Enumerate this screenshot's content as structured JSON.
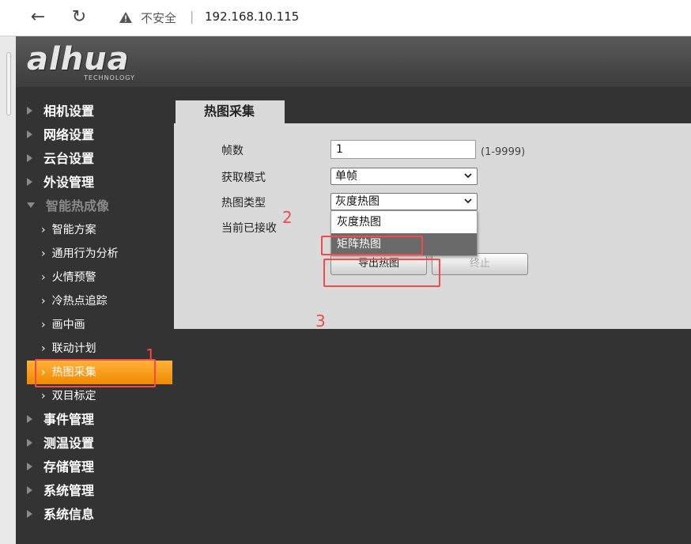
{
  "browser": {
    "back_icon": "←",
    "reload_icon": "↻",
    "insecure_label": "不安全",
    "separator": "|",
    "url": "192.168.10.115"
  },
  "header": {
    "logo": "alhua",
    "logo_sub": "TECHNOLOGY"
  },
  "sidebar": {
    "top_items": [
      {
        "label": "相机设置"
      },
      {
        "label": "网络设置"
      },
      {
        "label": "云台设置"
      },
      {
        "label": "外设管理"
      },
      {
        "label": "智能热成像"
      }
    ],
    "sub_items": [
      {
        "label": "智能方案"
      },
      {
        "label": "通用行为分析"
      },
      {
        "label": "火情预警"
      },
      {
        "label": "冷热点追踪"
      },
      {
        "label": "画中画"
      },
      {
        "label": "联动计划"
      },
      {
        "label": "热图采集"
      },
      {
        "label": "双目标定"
      }
    ],
    "bottom_items": [
      {
        "label": "事件管理"
      },
      {
        "label": "测温设置"
      },
      {
        "label": "存储管理"
      },
      {
        "label": "系统管理"
      },
      {
        "label": "系统信息"
      }
    ],
    "chevron": "›"
  },
  "content": {
    "tab_label": "热图采集",
    "frames_label": "帧数",
    "frames_value": "1",
    "frames_range": "(1-9999)",
    "mode_label": "获取模式",
    "mode_value": "单帧",
    "type_label": "热图类型",
    "type_value": "灰度热图",
    "received_label": "当前已接收",
    "dropdown_options": [
      "灰度热图",
      "矩阵热图"
    ],
    "export_button": "导出热图",
    "stop_button": "终止"
  },
  "annotations": {
    "step1": "1",
    "step2": "2",
    "step3": "3"
  },
  "colors": {
    "active_menu": "#f59a1a",
    "annotation": "#f44a4a",
    "panel_bg": "#dadada",
    "app_bg": "#333333"
  }
}
